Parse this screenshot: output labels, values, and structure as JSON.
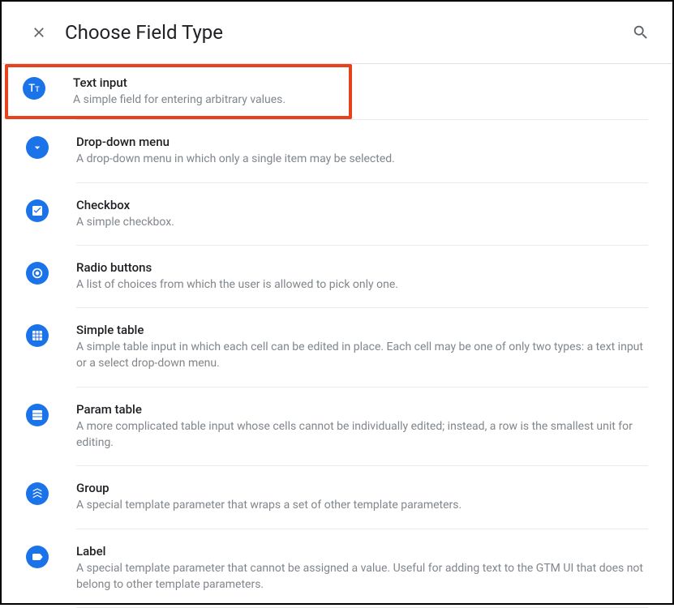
{
  "header": {
    "title": "Choose Field Type"
  },
  "field_types": [
    {
      "title": "Text input",
      "desc": "A simple field for entering arbitrary values.",
      "icon": "text",
      "highlighted": true
    },
    {
      "title": "Drop-down menu",
      "desc": "A drop-down menu in which only a single item may be selected.",
      "icon": "dropdown"
    },
    {
      "title": "Checkbox",
      "desc": "A simple checkbox.",
      "icon": "checkbox"
    },
    {
      "title": "Radio buttons",
      "desc": "A list of choices from which the user is allowed to pick only one.",
      "icon": "radio"
    },
    {
      "title": "Simple table",
      "desc": "A simple table input in which each cell can be edited in place. Each cell may be one of only two types: a text input or a select drop-down menu.",
      "icon": "table"
    },
    {
      "title": "Param table",
      "desc": "A more complicated table input whose cells cannot be individually edited; instead, a row is the smallest unit for editing.",
      "icon": "param-table"
    },
    {
      "title": "Group",
      "desc": "A special template parameter that wraps a set of other template parameters.",
      "icon": "group"
    },
    {
      "title": "Label",
      "desc": "A special template parameter that cannot be assigned a value. Useful for adding text to the GTM UI that does not belong to other template parameters.",
      "icon": "label"
    }
  ]
}
